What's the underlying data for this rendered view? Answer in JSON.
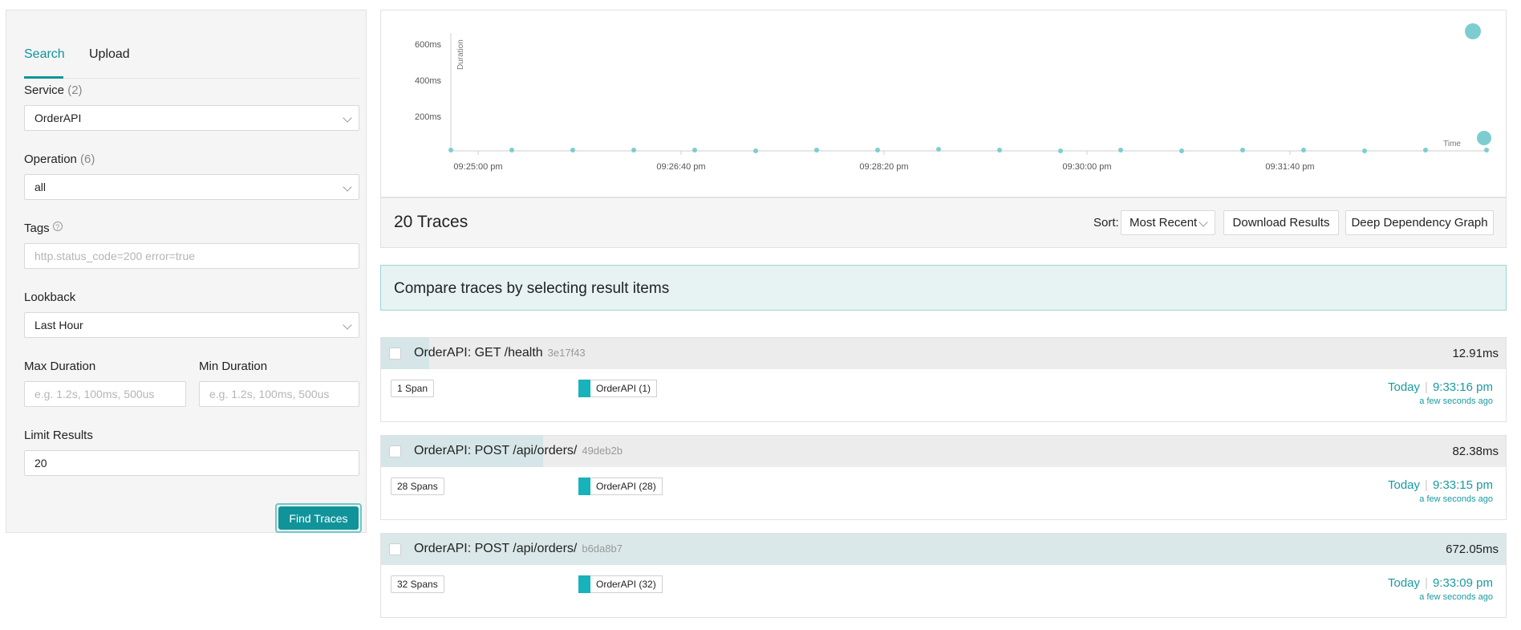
{
  "search_panel": {
    "tabs": [
      "Search",
      "Upload"
    ],
    "service": {
      "label": "Service",
      "count": "(2)",
      "value": "OrderAPI"
    },
    "operation": {
      "label": "Operation",
      "count": "(6)",
      "value": "all"
    },
    "tags": {
      "label": "Tags",
      "help_icon": "?",
      "placeholder": "http.status_code=200 error=true"
    },
    "lookback": {
      "label": "Lookback",
      "value": "Last Hour"
    },
    "max_duration": {
      "label": "Max Duration",
      "placeholder": "e.g. 1.2s, 100ms, 500us"
    },
    "min_duration": {
      "label": "Min Duration",
      "placeholder": "e.g. 1.2s, 100ms, 500us"
    },
    "limit": {
      "label": "Limit Results",
      "value": "20"
    },
    "find_button": "Find Traces"
  },
  "plot": {
    "y_axis_label": "Duration",
    "x_axis_label": "Time",
    "y_ticks": [
      "600ms",
      "400ms",
      "200ms"
    ],
    "x_ticks": [
      "09:25:00 pm",
      "09:26:40 pm",
      "09:28:20 pm",
      "09:30:00 pm",
      "09:31:40 pm"
    ],
    "point_color": "#7dcdd0"
  },
  "results": {
    "count_title": "20 Traces",
    "sort_label": "Sort:",
    "sort_value": "Most Recent",
    "download_button": "Download Results",
    "ddg_button": "Deep Dependency Graph",
    "compare_text": "Compare traces by selecting result items"
  },
  "traces": [
    {
      "name": "OrderAPI: GET /health",
      "id": "3e17f43",
      "duration": "12.91ms",
      "spans": "1 Span",
      "service": "OrderAPI (1)",
      "day": "Today",
      "time": "9:33:16 pm",
      "ago": "a few seconds ago"
    },
    {
      "name": "OrderAPI: POST /api/orders/",
      "id": "49deb2b",
      "duration": "82.38ms",
      "spans": "28 Spans",
      "service": "OrderAPI (28)",
      "day": "Today",
      "time": "9:33:15 pm",
      "ago": "a few seconds ago"
    },
    {
      "name": "OrderAPI: POST /api/orders/",
      "id": "b6da8b7",
      "duration": "672.05ms",
      "spans": "32 Spans",
      "service": "OrderAPI (32)",
      "day": "Today",
      "time": "9:33:09 pm",
      "ago": "a few seconds ago"
    }
  ],
  "colors": {
    "accent": "#11939a",
    "service_swatch": "#18b2ba"
  }
}
